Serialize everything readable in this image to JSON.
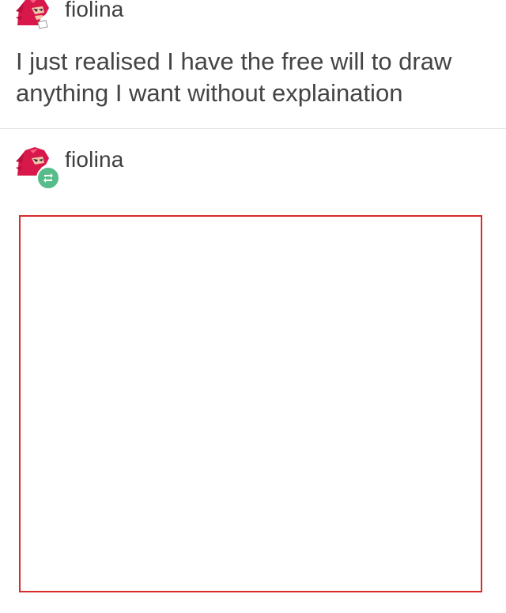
{
  "original_post": {
    "username": "fiolina",
    "avatar_icon": "knuckles-avatar-icon",
    "text": "I just realised I have the free will to draw anything I want without explaination"
  },
  "reblog": {
    "username": "fiolina",
    "avatar_icon": "knuckles-avatar-icon",
    "badge_icon": "reblog-icon",
    "badge_color": "#56bc8a"
  },
  "drawing": {
    "border_color": "#d92b2b"
  }
}
